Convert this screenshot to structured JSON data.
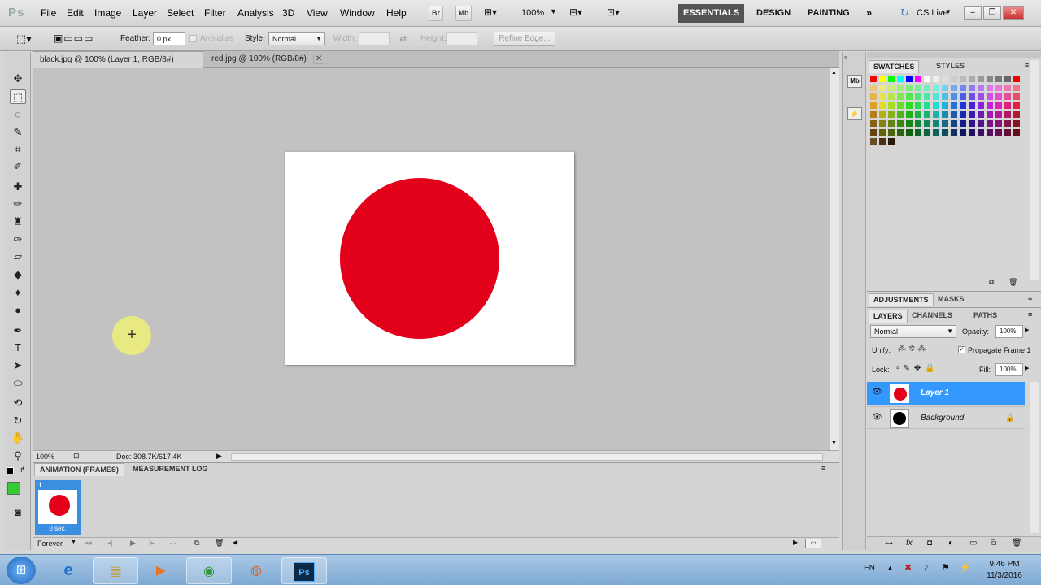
{
  "app": {
    "logo": "Ps"
  },
  "menu": [
    "File",
    "Edit",
    "Image",
    "Layer",
    "Select",
    "Filter",
    "Analysis",
    "3D",
    "View",
    "Window",
    "Help"
  ],
  "appbar": {
    "bridge": "Br",
    "minibridge": "Mb",
    "zoom": "100%"
  },
  "workspaces": [
    "ESSENTIALS",
    "DESIGN",
    "PAINTING"
  ],
  "cs_live": "CS Live",
  "options": {
    "feather_label": "Feather:",
    "feather_value": "0 px",
    "antialias_label": "Anti-alias",
    "style_label": "Style:",
    "style_value": "Normal",
    "width_label": "Width:",
    "height_label": "Height:",
    "refine_edge": "Refine Edge..."
  },
  "tabs": [
    {
      "label": "black.jpg @ 100% (Layer 1, RGB/8#) *"
    },
    {
      "label": "red.jpg @ 100% (RGB/8#)"
    }
  ],
  "status": {
    "zoom": "100%",
    "doc": "Doc: 308.7K/617.4K"
  },
  "anim_panel": {
    "tab_frames": "ANIMATION (FRAMES)",
    "tab_log": "MEASUREMENT LOG",
    "frame_number": "1",
    "frame_duration": "0 sec.",
    "loop": "Forever"
  },
  "swatches_panel": {
    "tab_swatches": "SWATCHES",
    "tab_styles": "STYLES"
  },
  "adjust_panel": {
    "tab_adjustments": "ADJUSTMENTS",
    "tab_masks": "MASKS"
  },
  "layers_panel": {
    "tab_layers": "LAYERS",
    "tab_channels": "CHANNELS",
    "tab_paths": "PATHS",
    "blend_mode": "Normal",
    "opacity_label": "Opacity:",
    "opacity_value": "100%",
    "unify_label": "Unify:",
    "propagate_label": "Propagate Frame 1",
    "lock_label": "Lock:",
    "fill_label": "Fill:",
    "fill_value": "100%",
    "layers": [
      {
        "name": "Layer 1",
        "thumb_color": "#e2001a",
        "selected": true
      },
      {
        "name": "Background",
        "thumb_color": "#000000",
        "selected": false
      }
    ]
  },
  "taskbar": {
    "lang": "EN",
    "time": "9:46 PM",
    "date": "11/3/2016"
  },
  "colors": {
    "accent_red": "#e2001a",
    "selection_blue": "#3399ff",
    "foreground": "#1a1a1a",
    "background_swatch": "#33cc33"
  }
}
